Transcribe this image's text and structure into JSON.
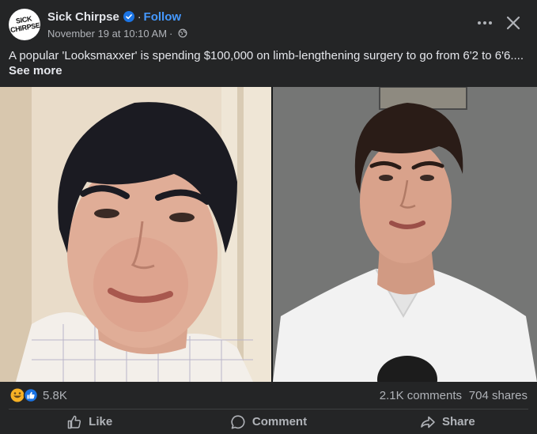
{
  "post": {
    "author": "Sick Chirpse",
    "avatar_text": "SICK CHIRPSE",
    "follow_label": "Follow",
    "separator": "·",
    "timestamp": "November 19 at 10:10 AM",
    "meta_separator": "·",
    "audience_icon": "globe-icon",
    "caption": "A popular 'Looksmaxxer' is spending $100,000 on limb-lengthening surgery to go from 6'2 to 6'6....",
    "see_more_label": "See more"
  },
  "header_icons": {
    "more": "more-options-icon",
    "close": "close-icon"
  },
  "stats": {
    "reactions": "5.8K",
    "reaction_types": [
      "haha",
      "like"
    ],
    "comments": "2.1K comments",
    "shares": "704 shares"
  },
  "actions": {
    "like": "Like",
    "comment": "Comment",
    "share": "Share"
  },
  "colors": {
    "background": "#242526",
    "text_primary": "#e4e6eb",
    "text_secondary": "#b0b3b8",
    "link_blue": "#4599ff",
    "verified_blue": "#1b74e4"
  }
}
